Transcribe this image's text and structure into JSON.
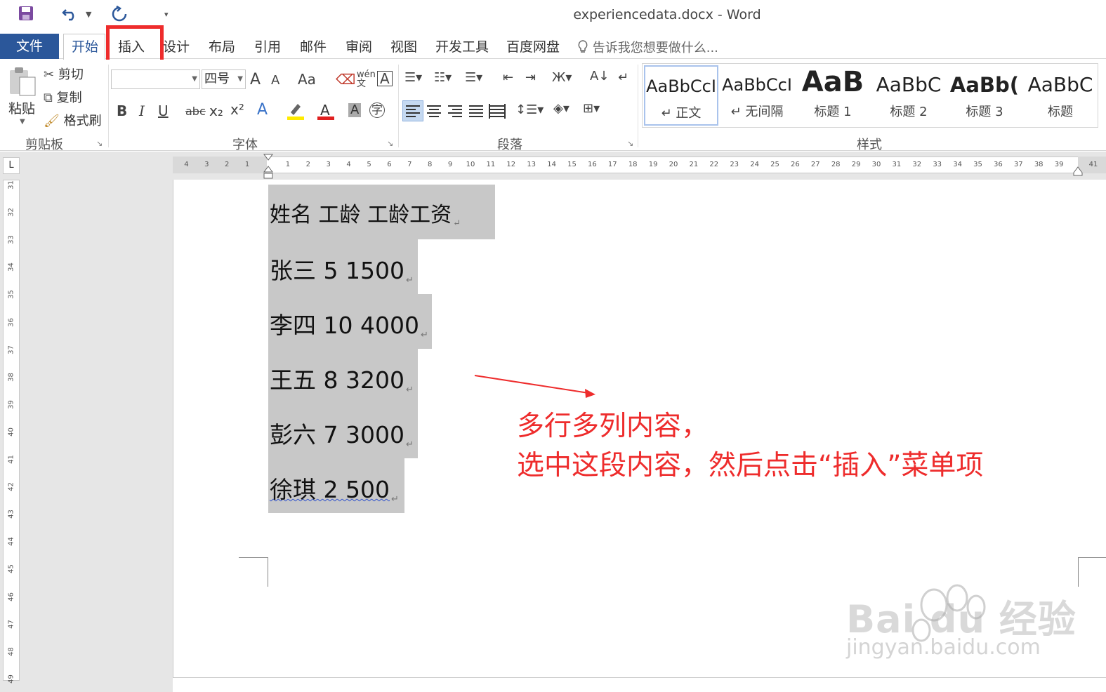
{
  "window": {
    "title": "experiencedata.docx - Word"
  },
  "quick_access": {
    "icons": [
      "save-icon",
      "undo-icon",
      "redo-icon",
      "customize-icon"
    ]
  },
  "tabs": {
    "file": "文件",
    "items": [
      "开始",
      "插入",
      "设计",
      "布局",
      "引用",
      "邮件",
      "审阅",
      "视图",
      "开发工具",
      "百度网盘"
    ],
    "active": "开始",
    "highlighted": "插入",
    "tell_me": "告诉我您想要做什么..."
  },
  "clipboard": {
    "paste": "粘贴",
    "cut": "剪切",
    "copy": "复制",
    "format_painter": "格式刷",
    "label": "剪贴板"
  },
  "font": {
    "font_name": "",
    "font_size": "四号",
    "label": "字体",
    "grow": "A",
    "shrink": "A",
    "change_case": "Aa",
    "bold": "B",
    "italic": "I",
    "underline": "U",
    "strike": "abc",
    "sub": "x₂",
    "sup": "x²"
  },
  "paragraph": {
    "label": "段落"
  },
  "styles": {
    "label": "样式",
    "items": [
      {
        "sample": "AaBbCcI",
        "name": "正文",
        "selected": true
      },
      {
        "sample": "AaBbCcI",
        "name": "无间隔",
        "selected": false
      },
      {
        "sample": "AaB",
        "name": "标题 1",
        "selected": false
      },
      {
        "sample": "AaBbC",
        "name": "标题 2",
        "selected": false
      },
      {
        "sample": "AaBb(",
        "name": "标题 3",
        "selected": false
      },
      {
        "sample": "AaBbC",
        "name": "标题",
        "selected": false
      }
    ]
  },
  "ruler": {
    "corner": "L",
    "left_ticks": [
      "4",
      "3",
      "2",
      "1"
    ],
    "right_ticks": [
      "1",
      "2",
      "3",
      "4",
      "5",
      "6",
      "7",
      "8",
      "9",
      "10",
      "11",
      "12",
      "13",
      "14",
      "15",
      "16",
      "17",
      "18",
      "19",
      "20",
      "21",
      "22",
      "23",
      "24",
      "25",
      "26",
      "27",
      "28",
      "29",
      "30",
      "31",
      "32",
      "33",
      "34",
      "35",
      "36",
      "37",
      "38",
      "39"
    ],
    "end_tick": "41",
    "vertical_ticks": [
      "31",
      "32",
      "33",
      "34",
      "35",
      "36",
      "37",
      "38",
      "39",
      "40",
      "41",
      "42",
      "43",
      "44",
      "45",
      "46",
      "47",
      "48",
      "49"
    ]
  },
  "document": {
    "lines": [
      {
        "text": "姓名  工龄  工龄工资"
      },
      {
        "text": "张三  5 1500"
      },
      {
        "text": "李四  10 4000"
      },
      {
        "text": "王五  8 3200"
      },
      {
        "text": "彭六  7 3000"
      },
      {
        "text": "徐琪  2 500"
      }
    ],
    "paragraph_mark": "↵"
  },
  "annotation": {
    "line1": "多行多列内容，",
    "line2": "选中这段内容，然后点击“插入”菜单项",
    "color": "#ee2c2c"
  },
  "watermark": {
    "brand": "Bai du 经验",
    "url": "jingyan.baidu.com"
  },
  "colors": {
    "accent": "#2b579a",
    "highlight_red": "#ee2c2c",
    "selection": "#c8c8c8"
  }
}
